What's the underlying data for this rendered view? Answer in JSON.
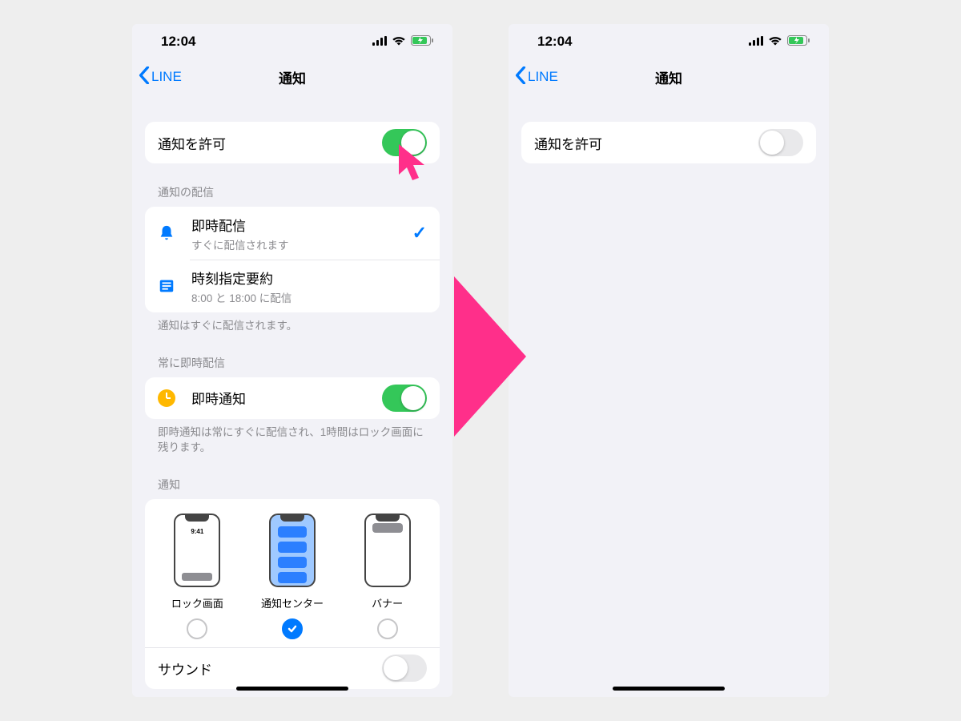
{
  "status": {
    "time": "12:04"
  },
  "nav": {
    "back_label": "LINE",
    "title": "通知"
  },
  "allow": {
    "label": "通知を許可"
  },
  "delivery": {
    "header": "通知の配信",
    "instant": {
      "title": "即時配信",
      "sub": "すぐに配信されます"
    },
    "scheduled": {
      "title": "時刻指定要約",
      "sub": "8:00 と 18:00 に配信"
    },
    "footer": "通知はすぐに配信されます。"
  },
  "always": {
    "header": "常に即時配信",
    "label": "即時通知",
    "footer": "即時通知は常にすぐに配信され、1時間はロック画面に残ります。"
  },
  "styles": {
    "header": "通知",
    "lock": {
      "label": "ロック画面",
      "time": "9:41"
    },
    "center": {
      "label": "通知センター"
    },
    "banner": {
      "label": "バナー"
    }
  },
  "sound": {
    "label": "サウンド"
  },
  "colors": {
    "accent": "#007aff",
    "toggle_on": "#34c759",
    "pink": "#ff2f8a"
  }
}
